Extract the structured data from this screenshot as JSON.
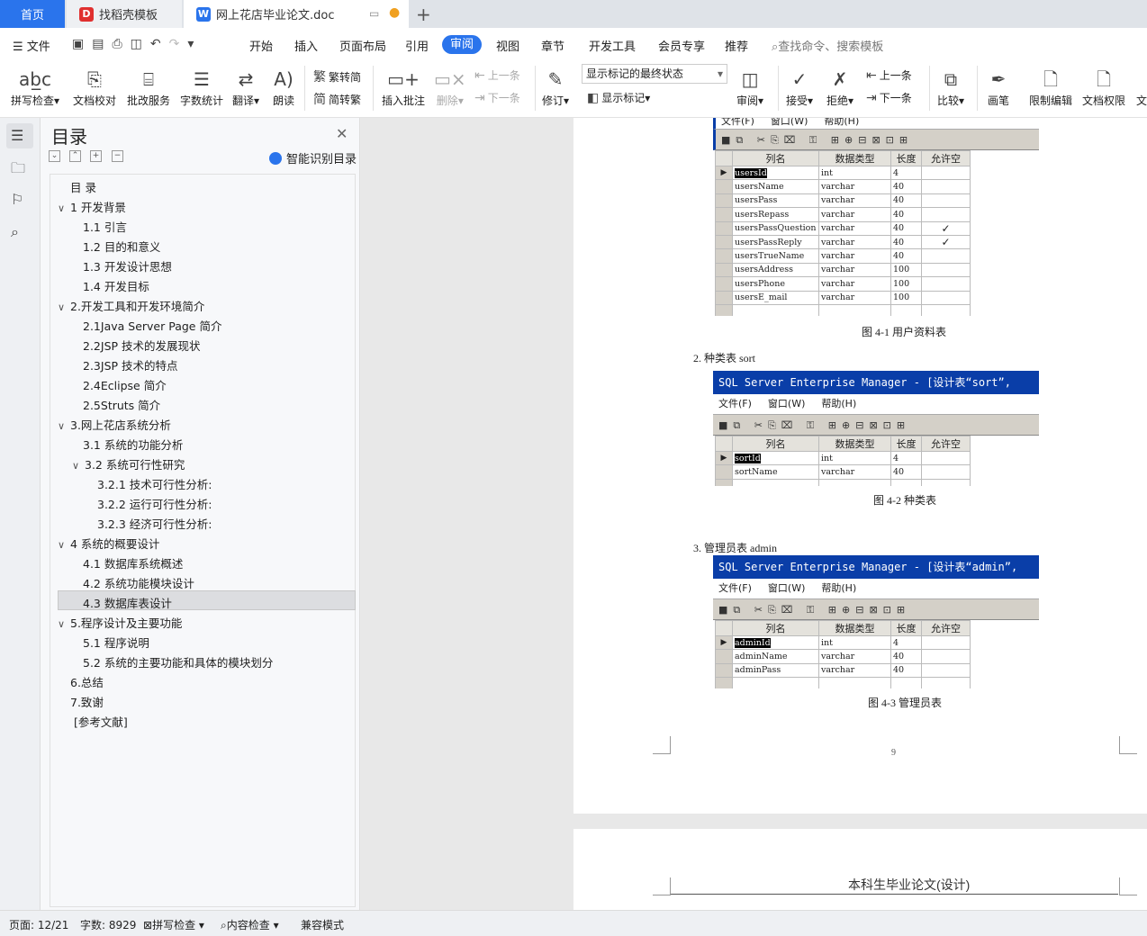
{
  "tabs": {
    "home": "首页",
    "template": "找稻壳模板",
    "doc": "网上花店毕业论文.doc"
  },
  "menu": {
    "file": "文件",
    "items": [
      "开始",
      "插入",
      "页面布局",
      "引用",
      "审阅",
      "视图",
      "章节",
      "开发工具",
      "会员专享",
      "推荐"
    ],
    "active": "审阅",
    "search_placeholder": "查找命令、搜索模板"
  },
  "toolbar": {
    "spell_check": "拼写检查",
    "doc_check": "文档校对",
    "batch_service": "批改服务",
    "word_count": "字数统计",
    "translate": "翻译",
    "read_aloud": "朗读",
    "trad_to_simp": "繁转简",
    "simp_to_trad": "简转繁",
    "insert_comment": "插入批注",
    "delete": "删除",
    "prev_comment": "上一条",
    "next_comment": "下一条",
    "revise": "修订",
    "markup_state": "显示标记的最终状态",
    "show_markup": "显示标记",
    "review": "审阅",
    "accept": "接受",
    "reject": "拒绝",
    "prev": "上一条",
    "next": "下一条",
    "compare": "比较",
    "ink": "画笔",
    "restrict_edit": "限制编辑",
    "doc_rights": "文档权限",
    "more": "文"
  },
  "nav": {
    "title": "目录",
    "smart": "智能识别目录",
    "toc": [
      {
        "t": "目 录",
        "lv": 0,
        "car": ""
      },
      {
        "t": "1 开发背景",
        "lv": 0,
        "car": "v"
      },
      {
        "t": "1.1 引言",
        "lv": 1,
        "car": ""
      },
      {
        "t": "1.2 目的和意义",
        "lv": 1,
        "car": ""
      },
      {
        "t": "1.3 开发设计思想",
        "lv": 1,
        "car": ""
      },
      {
        "t": "1.4 开发目标",
        "lv": 1,
        "car": ""
      },
      {
        "t": "2.开发工具和开发环境简介",
        "lv": 0,
        "car": "v"
      },
      {
        "t": "2.1Java Server Page 简介",
        "lv": 1,
        "car": ""
      },
      {
        "t": "2.2JSP 技术的发展现状",
        "lv": 1,
        "car": ""
      },
      {
        "t": "2.3JSP 技术的特点",
        "lv": 1,
        "car": ""
      },
      {
        "t": "2.4Eclipse 简介",
        "lv": 1,
        "car": ""
      },
      {
        "t": "2.5Struts 简介",
        "lv": 1,
        "car": ""
      },
      {
        "t": "3.网上花店系统分析",
        "lv": 0,
        "car": "v"
      },
      {
        "t": "3.1 系统的功能分析",
        "lv": 1,
        "car": ""
      },
      {
        "t": "3.2 系统可行性研究",
        "lv": 1,
        "car": "v"
      },
      {
        "t": "3.2.1 技术可行性分析:",
        "lv": 2,
        "car": ""
      },
      {
        "t": "3.2.2 运行可行性分析:",
        "lv": 2,
        "car": ""
      },
      {
        "t": "3.2.3 经济可行性分析:",
        "lv": 2,
        "car": ""
      },
      {
        "t": "4 系统的概要设计",
        "lv": 0,
        "car": "v"
      },
      {
        "t": "4.1 数据库系统概述",
        "lv": 1,
        "car": ""
      },
      {
        "t": "4.2 系统功能模块设计",
        "lv": 1,
        "car": ""
      },
      {
        "t": "4.3 数据库表设计",
        "lv": 1,
        "car": ""
      },
      {
        "t": "5.程序设计及主要功能",
        "lv": 0,
        "car": "v"
      },
      {
        "t": "5.1 程序说明",
        "lv": 1,
        "car": ""
      },
      {
        "t": "5.2 系统的主要功能和具体的模块划分",
        "lv": 1,
        "car": ""
      },
      {
        "t": "6.总结",
        "lv": 0,
        "car": ""
      },
      {
        "t": "7.致谢",
        "lv": 0,
        "car": ""
      },
      {
        "t": "[参考文献]",
        "lv": 0,
        "car": ""
      }
    ]
  },
  "doc": {
    "sm_menu": [
      "文件(F)",
      "窗口(W)",
      "帮助(H)"
    ],
    "col_headers": [
      "列名",
      "数据类型",
      "长度",
      "允许空"
    ],
    "users_rows": [
      [
        "usersId",
        "int",
        "4",
        ""
      ],
      [
        "usersName",
        "varchar",
        "40",
        ""
      ],
      [
        "usersPass",
        "varchar",
        "40",
        ""
      ],
      [
        "usersRepass",
        "varchar",
        "40",
        ""
      ],
      [
        "usersPassQuestion",
        "varchar",
        "40",
        "✓"
      ],
      [
        "usersPassReply",
        "varchar",
        "40",
        "✓"
      ],
      [
        "usersTrueName",
        "varchar",
        "40",
        ""
      ],
      [
        "usersAddress",
        "varchar",
        "100",
        ""
      ],
      [
        "usersPhone",
        "varchar",
        "100",
        ""
      ],
      [
        "usersE_mail",
        "varchar",
        "100",
        ""
      ]
    ],
    "cap1": "图 4-1 用户资料表",
    "item2": "2.   种类表 sort",
    "title2": "SQL Server Enterprise Manager - [设计表“sort”,",
    "sort_rows": [
      [
        "sortId",
        "int",
        "4",
        ""
      ],
      [
        "sortName",
        "varchar",
        "40",
        ""
      ]
    ],
    "cap2": "图 4-2 种类表",
    "item3": "3.   管理员表 admin",
    "title3": "SQL Server Enterprise Manager - [设计表“admin”,",
    "admin_rows": [
      [
        "adminId",
        "int",
        "4",
        ""
      ],
      [
        "adminName",
        "varchar",
        "40",
        ""
      ],
      [
        "adminPass",
        "varchar",
        "40",
        ""
      ]
    ],
    "cap3": "图 4-3 管理员表",
    "page_num": "9",
    "header2": "本科生毕业论文(设计)"
  },
  "status": {
    "page": "页面: 12/21",
    "words": "字数: 8929",
    "spell": "拼写检查",
    "content": "内容检查",
    "compat": "兼容模式"
  }
}
